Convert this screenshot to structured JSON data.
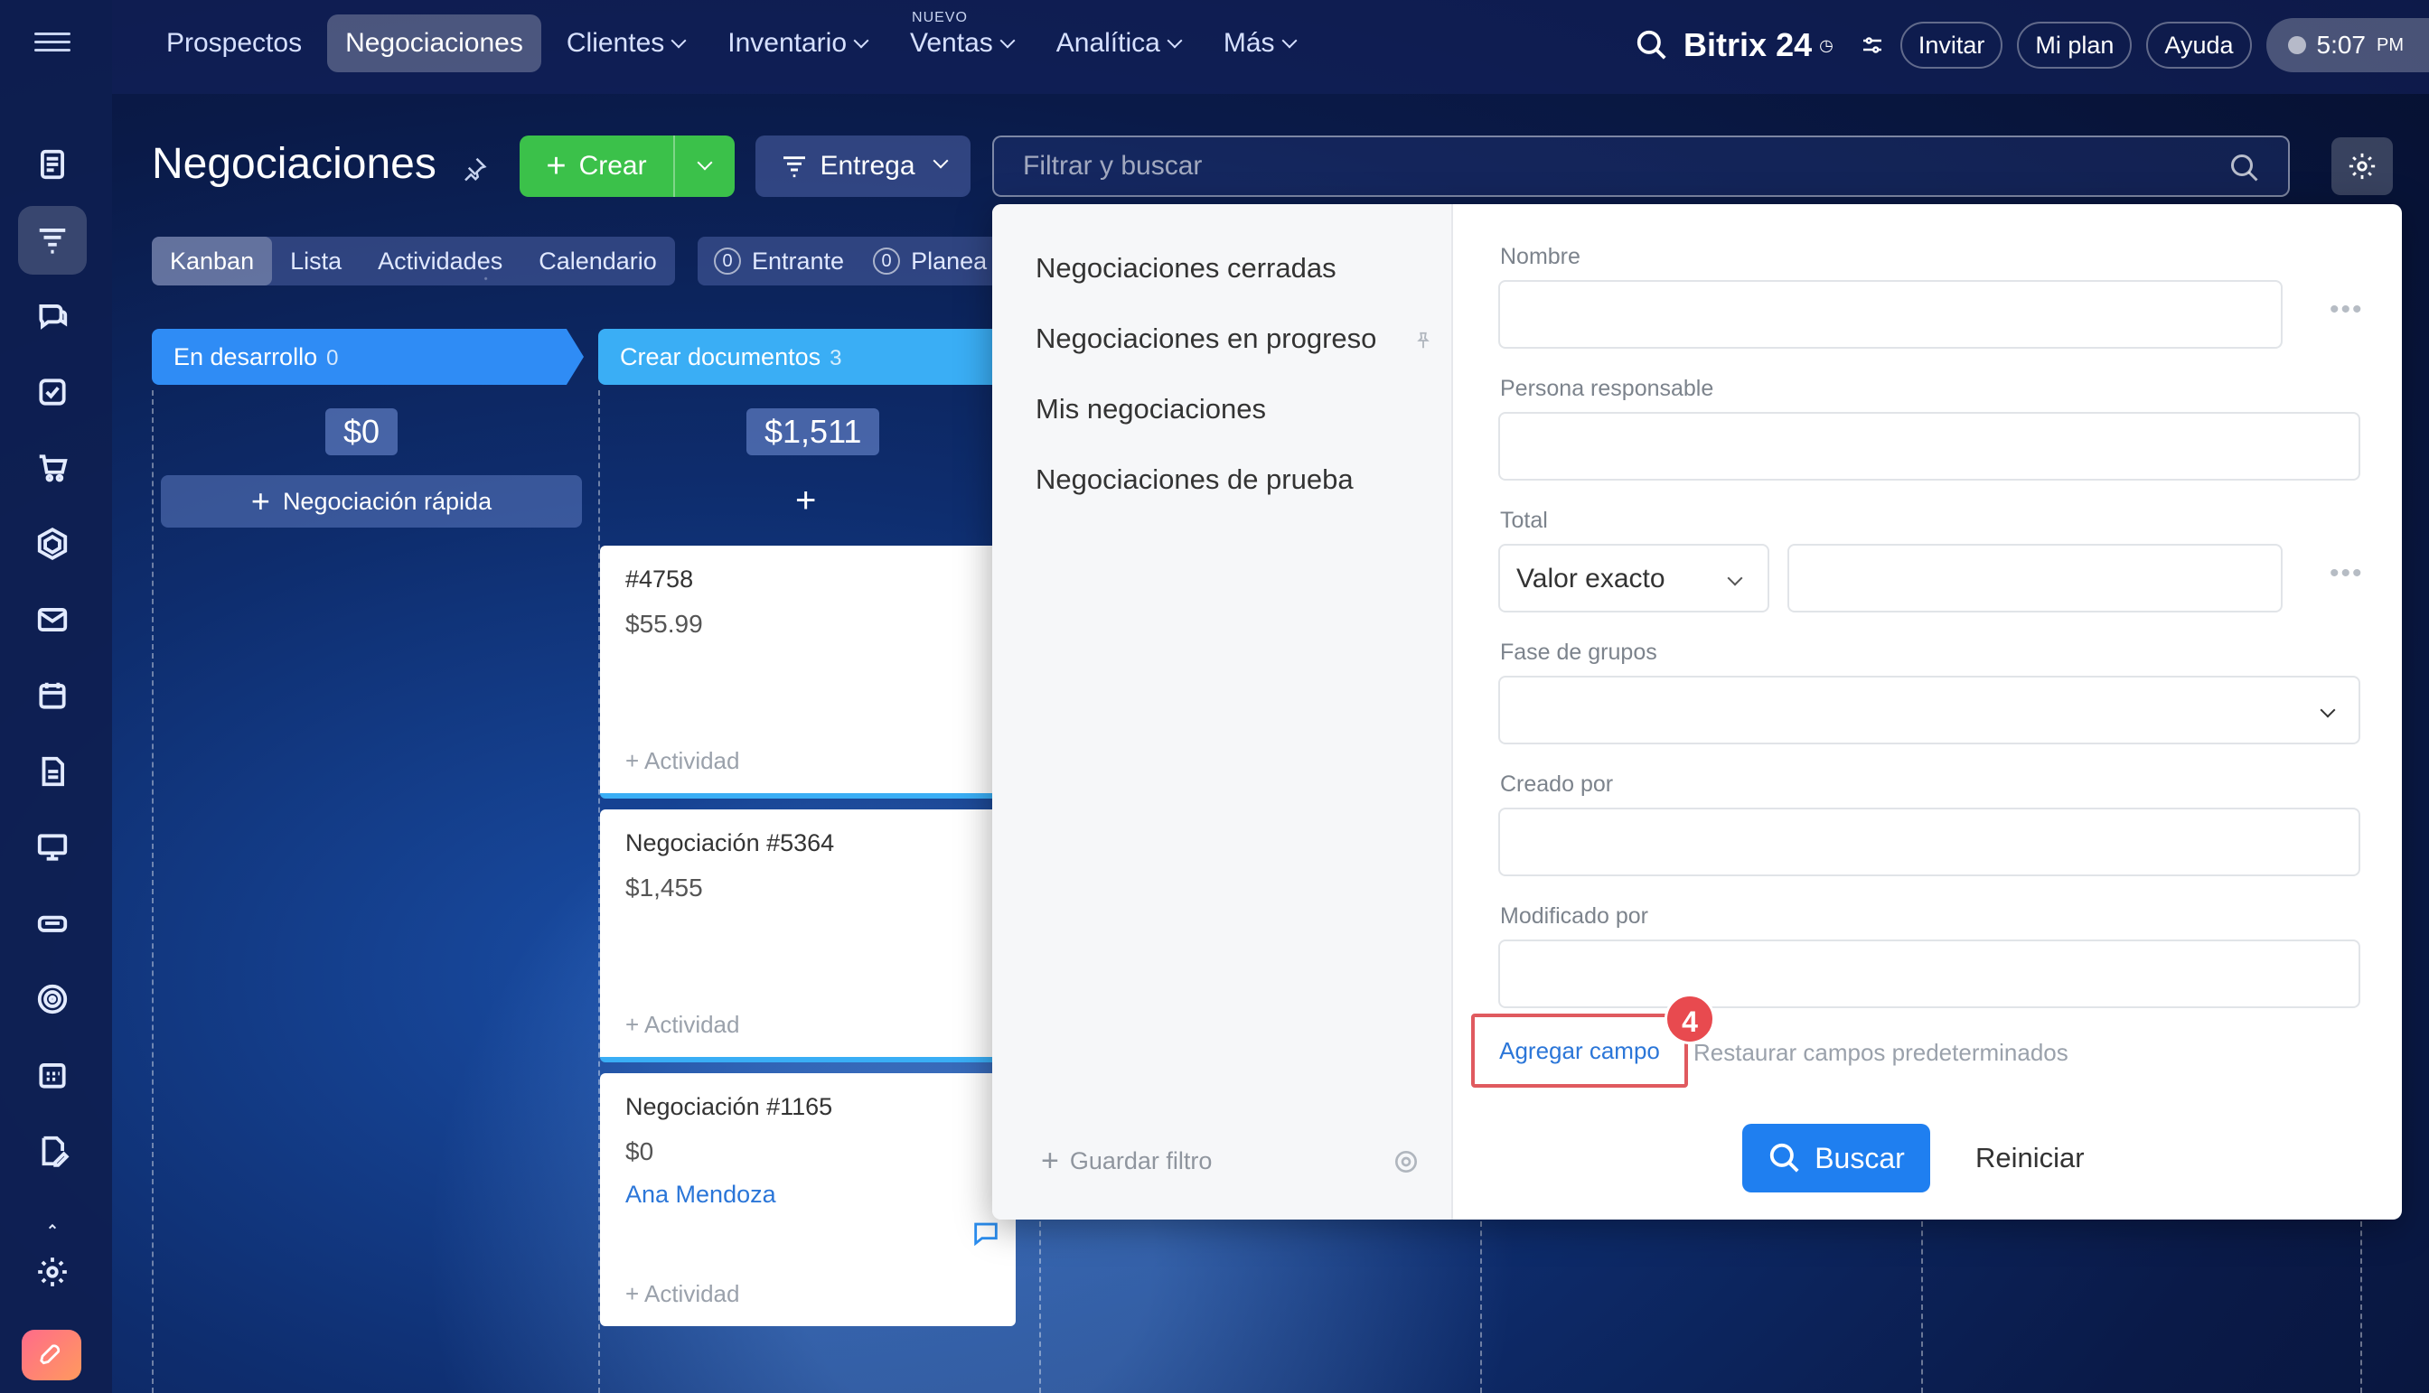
{
  "topnav": {
    "items": [
      {
        "label": "Prospectos",
        "active": false,
        "dropdown": false
      },
      {
        "label": "Negociaciones",
        "active": true,
        "dropdown": false
      },
      {
        "label": "Clientes",
        "active": false,
        "dropdown": true
      },
      {
        "label": "Inventario",
        "active": false,
        "dropdown": true
      },
      {
        "label": "Ventas",
        "active": false,
        "dropdown": true,
        "tag": "NUEVO"
      },
      {
        "label": "Analítica",
        "active": false,
        "dropdown": true
      },
      {
        "label": "Más",
        "active": false,
        "dropdown": true
      }
    ],
    "brand": "Bitrix 24",
    "invite": "Invitar",
    "plan": "Mi plan",
    "help": "Ayuda",
    "time": "5:07",
    "ampm": "PM"
  },
  "header": {
    "title": "Negociaciones",
    "create_label": "Crear",
    "pipeline_label": "Entrega",
    "search_placeholder": "Filtrar y buscar"
  },
  "views": [
    "Kanban",
    "Lista",
    "Actividades",
    "Calendario"
  ],
  "counters": [
    {
      "count": "0",
      "label": "Entrante"
    },
    {
      "count": "0",
      "label": "Planea"
    }
  ],
  "columns": [
    {
      "name": "En desarrollo",
      "count": "0",
      "sum": "$0",
      "quick_add": "Negociación rápida"
    },
    {
      "name": "Crear documentos",
      "count": "3",
      "sum": "$1,511"
    }
  ],
  "cards": [
    {
      "title": "#4758",
      "value": "$55.99",
      "person": "",
      "activity": "+ Actividad"
    },
    {
      "title": "Negociación #5364",
      "value": "$1,455",
      "person": "",
      "activity": "+ Actividad"
    },
    {
      "title": "Negociación #1165",
      "value": "$0",
      "person": "Ana Mendoza",
      "activity": "+ Actividad"
    }
  ],
  "filter": {
    "presets": [
      "Negociaciones cerradas",
      "Negociaciones en progreso",
      "Mis negociaciones",
      "Negociaciones de prueba"
    ],
    "save_filter": "Guardar filtro",
    "fields": {
      "name_label": "Nombre",
      "responsible_label": "Persona responsable",
      "total_label": "Total",
      "total_mode": "Valor exacto",
      "stage_group_label": "Fase de grupos",
      "created_by_label": "Creado por",
      "modified_by_label": "Modificado por"
    },
    "add_field": "Agregar campo",
    "step_number": "4",
    "restore_fields": "Restaurar campos predeterminados",
    "search_button": "Buscar",
    "reset_button": "Reiniciar"
  },
  "colors": {
    "accent": "#1f7ff0",
    "create": "#3bc14a",
    "highlight": "#e05a5f"
  }
}
